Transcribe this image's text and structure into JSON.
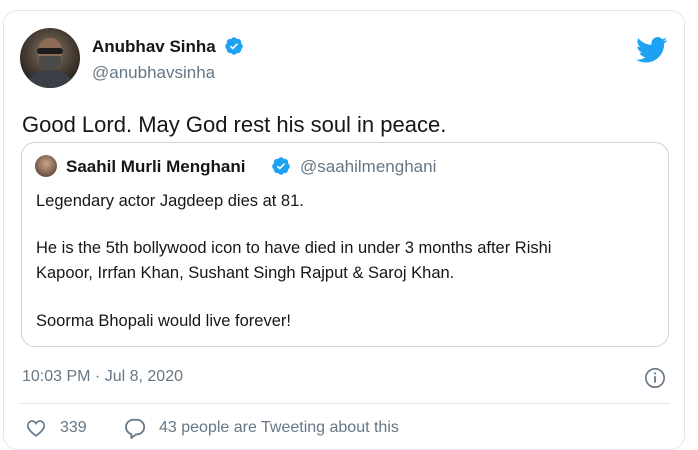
{
  "tweet": {
    "author_name": "Anubhav Sinha",
    "author_handle": "@anubhavsinha",
    "text": "Good Lord. May God rest his soul in peace.",
    "timestamp": "10:03 PM · Jul 8, 2020",
    "likes": "339",
    "tweeting": "43 people are Tweeting about this"
  },
  "quoted": {
    "author_name": "Saahil Murli Menghani",
    "author_handle": "@saahilmenghani",
    "lines": [
      "Legendary actor Jagdeep dies at 81.",
      "He is the 5th bollywood icon to have died in under 3 months after Rishi",
      "Kapoor, Irrfan Khan, Sushant Singh Rajput & Saroj Khan.",
      "Soorma Bhopali would live forever!"
    ]
  },
  "colors": {
    "twitter_blue": "#1da1f2",
    "secondary_text": "#657786",
    "border": "#e1e8ed"
  },
  "icons": [
    "verified-badge-icon",
    "twitter-bird-icon",
    "info-icon",
    "heart-icon",
    "reply-icon"
  ]
}
